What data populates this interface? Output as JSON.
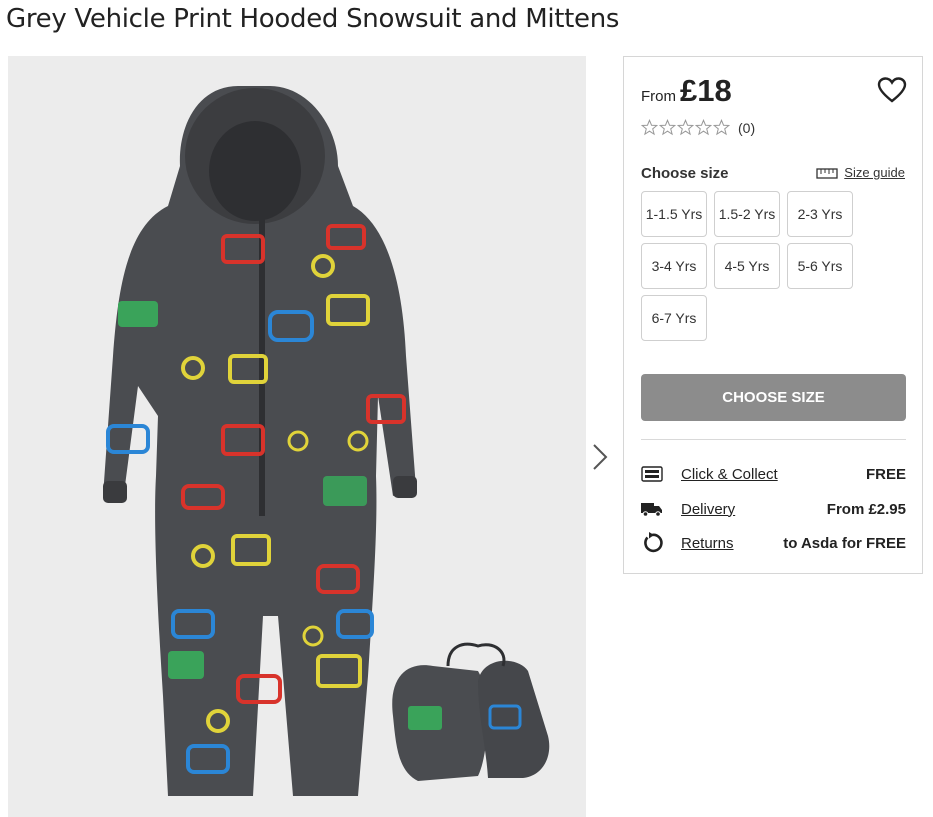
{
  "product": {
    "title": "Grey Vehicle Print Hooded Snowsuit and Mittens"
  },
  "buy_panel": {
    "price_prefix": "From",
    "price": "£18",
    "rating_count": "(0)",
    "choose_size_label": "Choose size",
    "size_guide_label": "Size guide",
    "sizes": [
      "1-1.5 Yrs",
      "1.5-2 Yrs",
      "2-3 Yrs",
      "3-4 Yrs",
      "4-5 Yrs",
      "5-6 Yrs",
      "6-7 Yrs"
    ],
    "cta_label": "CHOOSE SIZE",
    "services": [
      {
        "icon": "click-collect-icon",
        "label": "Click & Collect",
        "value": "FREE"
      },
      {
        "icon": "delivery-truck-icon",
        "label": "Delivery",
        "value": "From £2.95"
      },
      {
        "icon": "returns-icon",
        "label": "Returns",
        "value": "to Asda for FREE"
      }
    ]
  },
  "colors": {
    "cta_disabled": "#8c8c8c",
    "photo_bg": "#ececec",
    "suit": "#4a4c50"
  }
}
